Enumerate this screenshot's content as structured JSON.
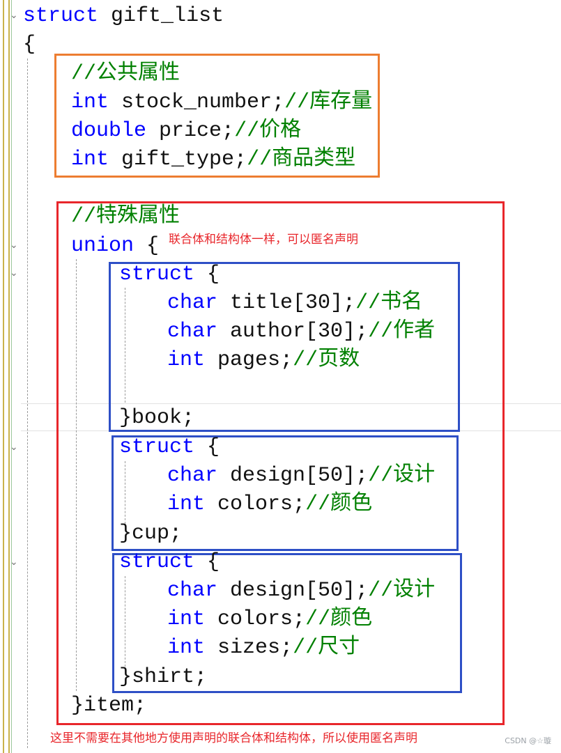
{
  "code": {
    "struct_header": {
      "keyword": "struct",
      "name": "gift_list"
    },
    "open_brace": "{",
    "public_comment": "//公共属性",
    "stock": {
      "type": "int",
      "decl": "stock_number;",
      "comment": "//库存量"
    },
    "price": {
      "type": "double",
      "decl": "price;",
      "comment": "//价格"
    },
    "gift_type": {
      "type": "int",
      "decl": "gift_type;",
      "comment": "//商品类型"
    },
    "special_comment": "//特殊属性",
    "union_header": {
      "keyword": "union",
      "brace": "{"
    },
    "book": {
      "header": {
        "keyword": "struct",
        "brace": "{"
      },
      "title": {
        "type": "char",
        "decl": "title[30];",
        "comment": "//书名"
      },
      "author": {
        "type": "char",
        "decl": "author[30];",
        "comment": "//作者"
      },
      "pages": {
        "type": "int",
        "decl": "pages;",
        "comment": "//页数"
      },
      "close": "}book;"
    },
    "cup": {
      "header": {
        "keyword": "struct",
        "brace": "{"
      },
      "design": {
        "type": "char",
        "decl": "design[50];",
        "comment": "//设计"
      },
      "colors": {
        "type": "int",
        "decl": "colors;",
        "comment": "//颜色"
      },
      "close": "}cup;"
    },
    "shirt": {
      "header": {
        "keyword": "struct",
        "brace": "{"
      },
      "design": {
        "type": "char",
        "decl": "design[50];",
        "comment": "//设计"
      },
      "colors": {
        "type": "int",
        "decl": "colors;",
        "comment": "//颜色"
      },
      "sizes": {
        "type": "int",
        "decl": "sizes;",
        "comment": "//尺寸"
      },
      "close": "}shirt;"
    },
    "union_close": "}item;"
  },
  "annotations": {
    "union_note": "联合体和结构体一样，可以匿名声明",
    "bottom_note": "这里不需要在其他地方使用声明的联合体和结构体，所以使用匿名声明"
  },
  "watermark": "CSDN @☆璇",
  "colors": {
    "keyword": "#0000ff",
    "comment": "#008000",
    "public_box": "#ed7d31",
    "special_box": "#e8262b",
    "struct_box": "#2e4fc6",
    "note": "#e8262b"
  }
}
